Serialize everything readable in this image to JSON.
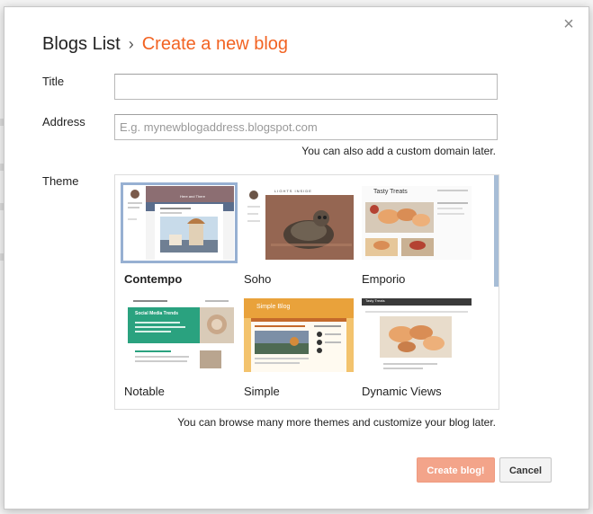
{
  "dialog": {
    "close_glyph": "×",
    "breadcrumb": {
      "parent": "Blogs List",
      "separator": "›",
      "current": "Create a new blog"
    }
  },
  "form": {
    "title_label": "Title",
    "title_value": "",
    "address_label": "Address",
    "address_value": "",
    "address_placeholder": "E.g. mynewblogaddress.blogspot.com",
    "address_hint": "You can also add a custom domain later.",
    "theme_label": "Theme",
    "theme_hint": "You can browse many more themes and customize your blog later."
  },
  "themes": [
    {
      "name": "Contempo",
      "selected": true
    },
    {
      "name": "Soho",
      "selected": false
    },
    {
      "name": "Emporio",
      "selected": false
    },
    {
      "name": "Notable",
      "selected": false
    },
    {
      "name": "Simple",
      "selected": false
    },
    {
      "name": "Dynamic Views",
      "selected": false
    }
  ],
  "thumb_text": {
    "contempo_heading": "Here and There",
    "soho_heading": "LIGHTS INSIDE",
    "emporio_heading": "Tasty Treats",
    "notable_heading": "Social Media Trends",
    "simple_heading": "Simple Blog",
    "dynamic_heading": "Tasty Treats"
  },
  "actions": {
    "create_label": "Create blog!",
    "cancel_label": "Cancel"
  },
  "colors": {
    "accent": "#f26322",
    "selection": "#97b0d2",
    "create_button": "#f3a48a",
    "notable_green": "#2aa27f",
    "simple_orange": "#e9a23b"
  }
}
